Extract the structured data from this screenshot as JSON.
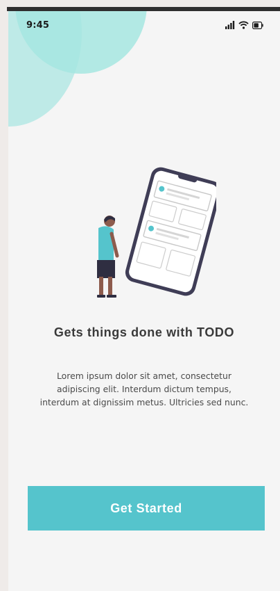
{
  "status_bar": {
    "time": "9:45",
    "icons": [
      "signal-icon",
      "wifi-icon",
      "battery-icon"
    ]
  },
  "onboarding": {
    "title": "Gets things done with TODO",
    "description": "Lorem ipsum dolor sit amet, consectetur adipiscing elit. Interdum dictum tempus, interdum at dignissim metus. Ultricies sed nunc.",
    "cta_label": "Get Started",
    "illustration_icon": "person-with-phone-illustration"
  },
  "colors": {
    "accent": "#55c4cc",
    "blob": "#8fe0da",
    "background": "#f5f5f5",
    "title_text": "#3a3a3a"
  }
}
